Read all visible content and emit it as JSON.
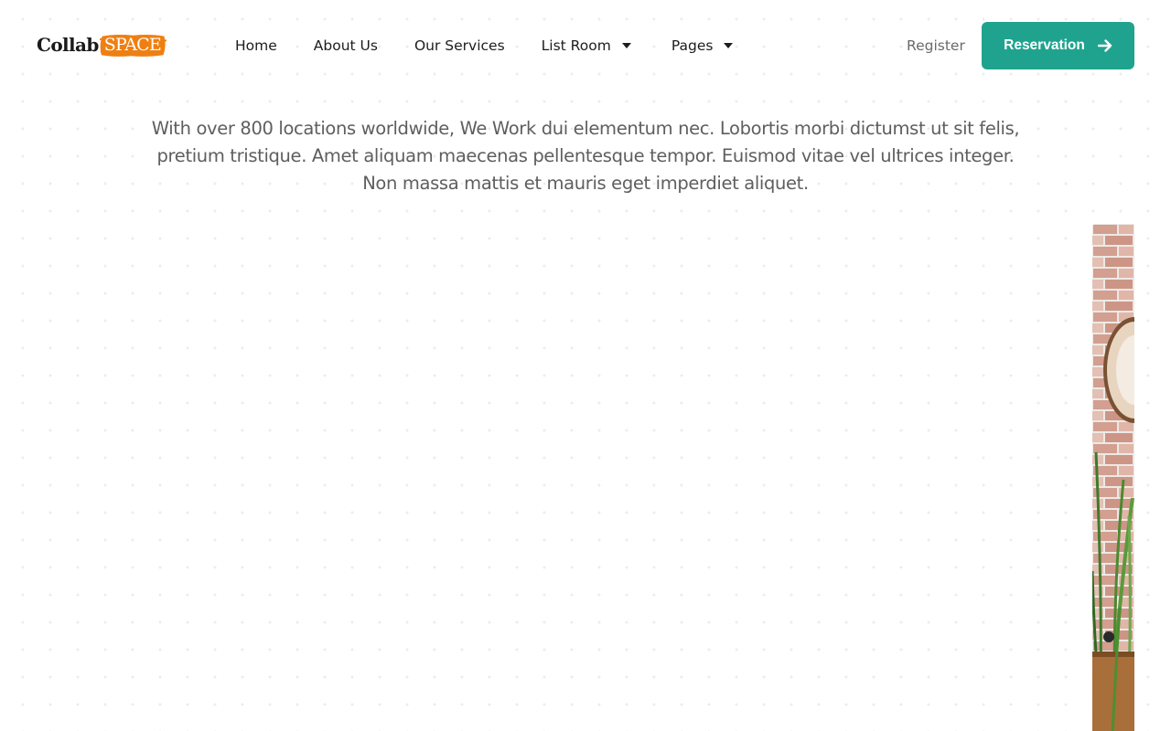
{
  "brand": {
    "name_prefix": "Collab",
    "name_badge": "SPACE",
    "badge_color": "#ef7f12"
  },
  "nav": {
    "items": [
      {
        "label": "Home",
        "has_dropdown": false
      },
      {
        "label": "About Us",
        "has_dropdown": false
      },
      {
        "label": "Our Services",
        "has_dropdown": false
      },
      {
        "label": "List Room",
        "has_dropdown": true
      },
      {
        "label": "Pages",
        "has_dropdown": true
      }
    ],
    "dropdown_icon": "caret-down-icon"
  },
  "actions": {
    "register_label": "Register",
    "reservation_label": "Reservation",
    "reservation_icon": "arrow-right-icon",
    "accent_color": "#1fa38f"
  },
  "intro": {
    "text": "With over 800 locations worldwide, We Work dui elementum nec. Lobortis morbi dictumst ut sit felis, pretium tristique. Amet aliquam maecenas pellentesque tempor. Euismod vitae vel ultrices integer. Non massa mattis et mauris eget imperdiet aliquet."
  },
  "gallery": {
    "image_subject": "brick wall with wall decoration and plant"
  }
}
